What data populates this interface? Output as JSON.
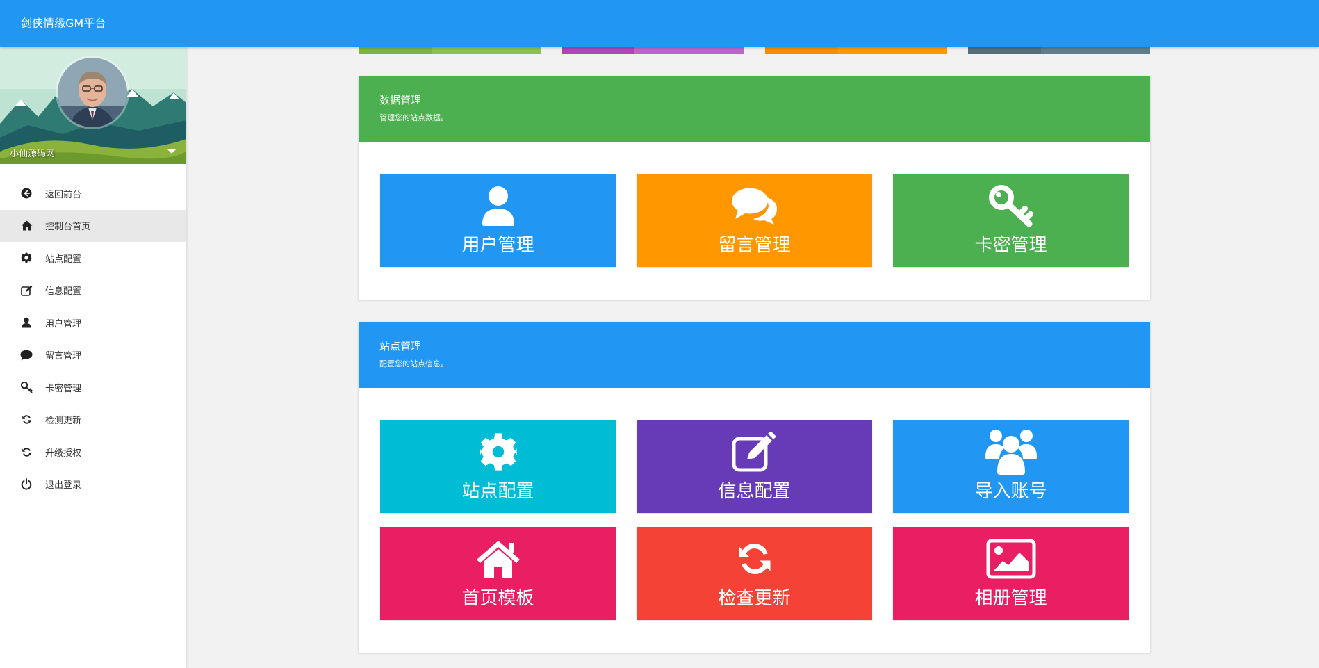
{
  "app": {
    "title": "剑侠情缘GM平台",
    "brand_color": "#2196f3"
  },
  "sidebar": {
    "profile": {
      "name": "小仙源码网",
      "avatar_icon": "user-avatar-photo"
    },
    "items": [
      {
        "label": "返回前台",
        "icon": "arrow-circle-left-icon",
        "active": false
      },
      {
        "label": "控制台首页",
        "icon": "home-icon",
        "active": true
      },
      {
        "label": "站点配置",
        "icon": "gear-icon",
        "active": false
      },
      {
        "label": "信息配置",
        "icon": "edit-icon",
        "active": false
      },
      {
        "label": "用户管理",
        "icon": "user-icon",
        "active": false
      },
      {
        "label": "留言管理",
        "icon": "comment-icon",
        "active": false
      },
      {
        "label": "卡密管理",
        "icon": "key-icon",
        "active": false
      },
      {
        "label": "检测更新",
        "icon": "refresh-icon",
        "active": false
      },
      {
        "label": "升级授权",
        "icon": "refresh-icon",
        "active": false
      },
      {
        "label": "退出登录",
        "icon": "power-icon",
        "active": false
      }
    ]
  },
  "top_strips": [
    {
      "color_a": "#7cb342",
      "color_b": "#8bc34a"
    },
    {
      "color_a": "#ab47bc",
      "color_b": "#ba68c8"
    },
    {
      "color_a": "#fb8c00",
      "color_b": "#ff9800"
    },
    {
      "color_a": "#546e7a",
      "color_b": "#607d8b"
    }
  ],
  "panels": {
    "data": {
      "title": "数据管理",
      "subtitle": "管理您的站点数据。",
      "color": "#4caf50",
      "tiles": [
        {
          "label": "用户管理",
          "icon": "user-icon",
          "color": "#2196f3"
        },
        {
          "label": "留言管理",
          "icon": "comments-icon",
          "color": "#ff9800"
        },
        {
          "label": "卡密管理",
          "icon": "key-icon",
          "color": "#4caf50"
        }
      ]
    },
    "site": {
      "title": "站点管理",
      "subtitle": "配置您的站点信息。",
      "color": "#2196f3",
      "tiles": [
        {
          "label": "站点配置",
          "icon": "gear-icon",
          "color": "#00bcd4"
        },
        {
          "label": "信息配置",
          "icon": "edit-icon",
          "color": "#673ab7"
        },
        {
          "label": "导入账号",
          "icon": "users-icon",
          "color": "#2196f3"
        },
        {
          "label": "首页模板",
          "icon": "home-icon",
          "color": "#e91e63"
        },
        {
          "label": "检查更新",
          "icon": "refresh-icon",
          "color": "#f44336"
        },
        {
          "label": "相册管理",
          "icon": "picture-icon",
          "color": "#e91e63"
        }
      ]
    }
  }
}
